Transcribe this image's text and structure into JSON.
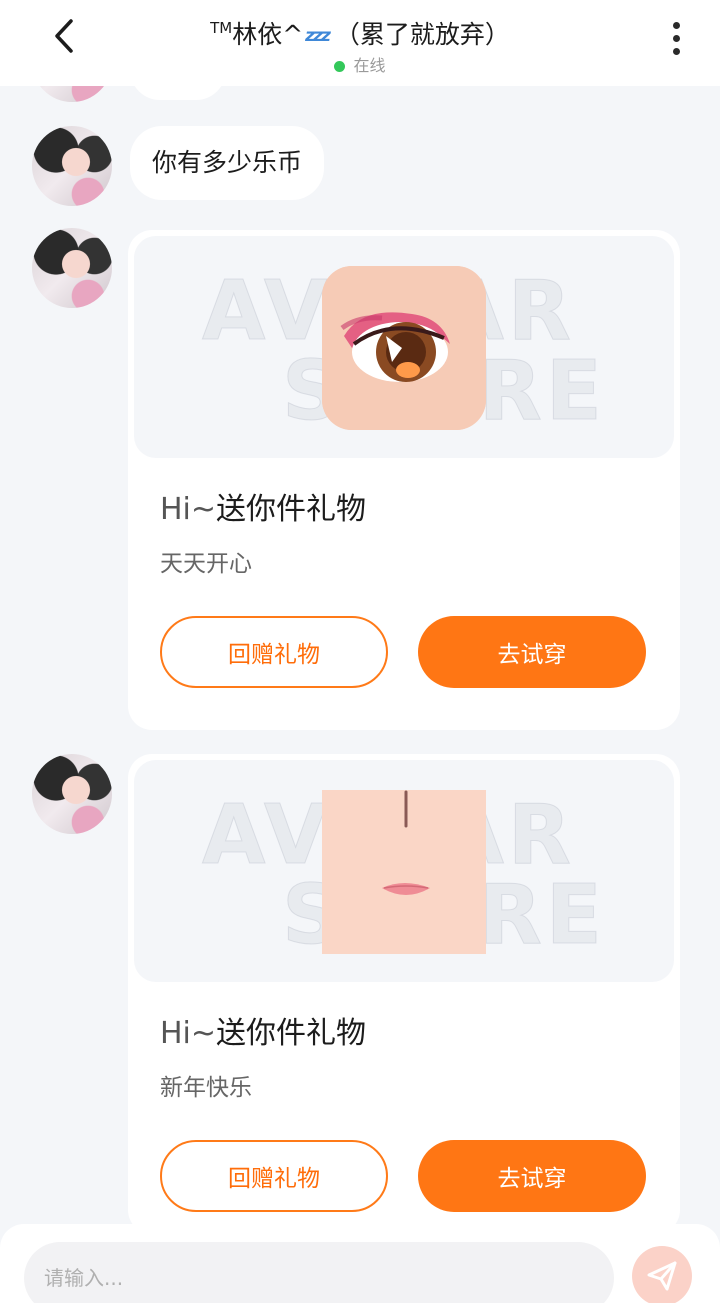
{
  "header": {
    "title_prefix": "TM",
    "title_name": "林依^",
    "title_zzz": "zzz",
    "title_suffix": "（累了就放弃）",
    "status": "在线"
  },
  "messages": [
    {
      "type": "text",
      "text": "你有多少乐币"
    },
    {
      "type": "gift",
      "title_hi": "Hi~",
      "title_main": "送你件礼物",
      "subtitle": "天天开心",
      "watermark_line1": "AVATAR",
      "watermark_line2": "STORE",
      "left_button": "回赠礼物",
      "right_button": "去试穿"
    },
    {
      "type": "gift",
      "title_hi": "Hi~",
      "title_main": "送你件礼物",
      "subtitle": "新年快乐",
      "watermark_line1": "AVATAR",
      "watermark_line2": "STORE",
      "left_button": "回赠礼物",
      "right_button": "去试穿"
    }
  ],
  "input": {
    "placeholder": "请输入..."
  },
  "colors": {
    "accent": "#ff7614",
    "online": "#33c85a",
    "background": "#f4f6f9"
  }
}
